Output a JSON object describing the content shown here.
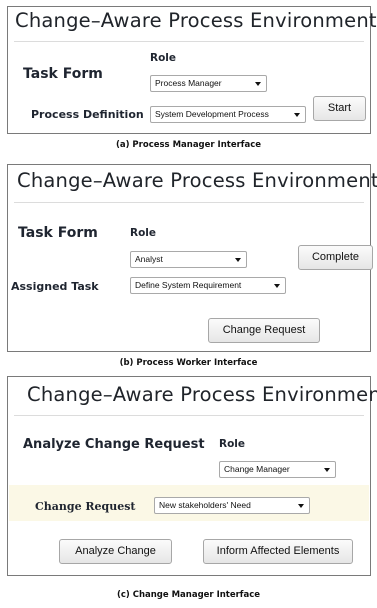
{
  "app_title": "Change–Aware Process Environment",
  "panel_a": {
    "task_form_label": "Task Form",
    "role_label": "Role",
    "role_value": "Process Manager",
    "process_definition_label": "Process Definition",
    "process_definition_value": "System Development Process",
    "start_label": "Start",
    "caption": "(a) Process Manager Interface"
  },
  "panel_b": {
    "task_form_label": "Task Form",
    "role_label": "Role",
    "role_value": "Analyst",
    "complete_label": "Complete",
    "assigned_task_label": "Assigned Task",
    "assigned_task_value": "Define System Requirement",
    "change_request_button": "Change Request",
    "caption": "(b) Process Worker Interface"
  },
  "panel_c": {
    "heading": "Analyze Change Request",
    "role_label": "Role",
    "role_value": "Change Manager",
    "change_request_label": "Change Request",
    "change_request_value": "New stakeholders' Need",
    "analyze_change_label": "Analyze Change",
    "inform_label": "Inform Affected Elements",
    "caption": "(c) Change Manager Interface"
  }
}
